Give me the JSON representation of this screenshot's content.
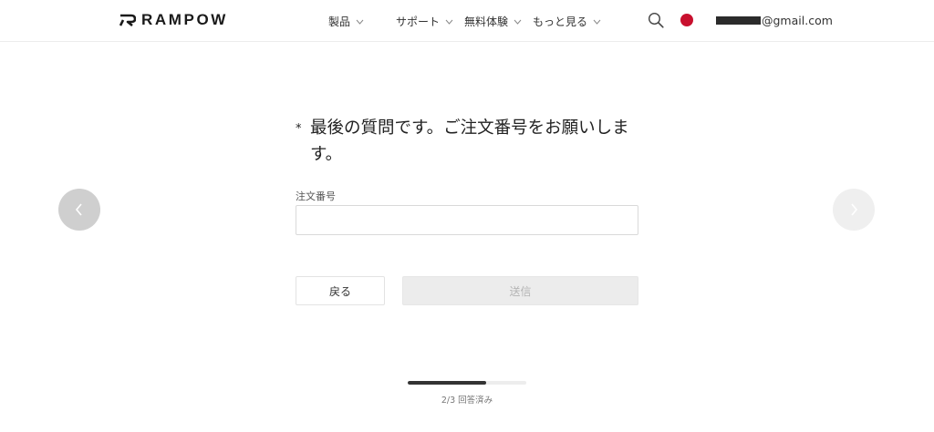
{
  "header": {
    "logo_text": "RAMPOW",
    "nav": [
      {
        "label": "製品"
      },
      {
        "label": "サポート"
      },
      {
        "label": "無料体験"
      },
      {
        "label": "もっと見る"
      }
    ],
    "icons": {
      "search": "search-icon",
      "region": "japan-flag-icon"
    },
    "account_email_visible": "@gmail.com",
    "flag_color": "#c8102e"
  },
  "form": {
    "required_mark": "*",
    "question": "最後の質問です。ご注文番号をお願いします。",
    "field_label": "注文番号",
    "input_value": "",
    "back_label": "戻る",
    "submit_label": "送信"
  },
  "carousel": {
    "prev_icon": "chevron-left-icon",
    "next_icon": "chevron-right-icon"
  },
  "progress": {
    "fraction": 0.66,
    "text": "2/3 回答済み"
  }
}
